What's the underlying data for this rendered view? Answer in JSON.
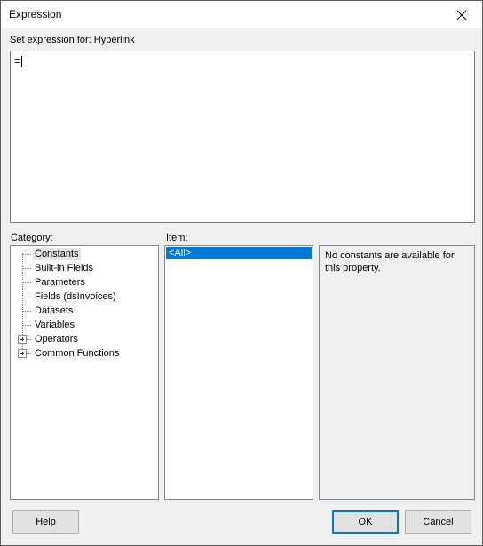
{
  "window": {
    "title": "Expression",
    "close_icon": "close-icon"
  },
  "header": {
    "label": "Set expression for: Hyperlink"
  },
  "editor": {
    "value": "="
  },
  "category": {
    "label": "Category:",
    "items": [
      {
        "label": "Constants",
        "expandable": false,
        "selected": true
      },
      {
        "label": "Built-in Fields",
        "expandable": false,
        "selected": false
      },
      {
        "label": "Parameters",
        "expandable": false,
        "selected": false
      },
      {
        "label": "Fields (dsInvoices)",
        "expandable": false,
        "selected": false
      },
      {
        "label": "Datasets",
        "expandable": false,
        "selected": false
      },
      {
        "label": "Variables",
        "expandable": false,
        "selected": false
      },
      {
        "label": "Operators",
        "expandable": true,
        "selected": false
      },
      {
        "label": "Common Functions",
        "expandable": true,
        "selected": false
      }
    ]
  },
  "item": {
    "label": "Item:",
    "items": [
      {
        "label": "<All>",
        "selected": true
      }
    ]
  },
  "description": {
    "text": "No constants are available for this property."
  },
  "buttons": {
    "help": "Help",
    "ok": "OK",
    "cancel": "Cancel"
  },
  "colors": {
    "accent": "#0078d7"
  }
}
